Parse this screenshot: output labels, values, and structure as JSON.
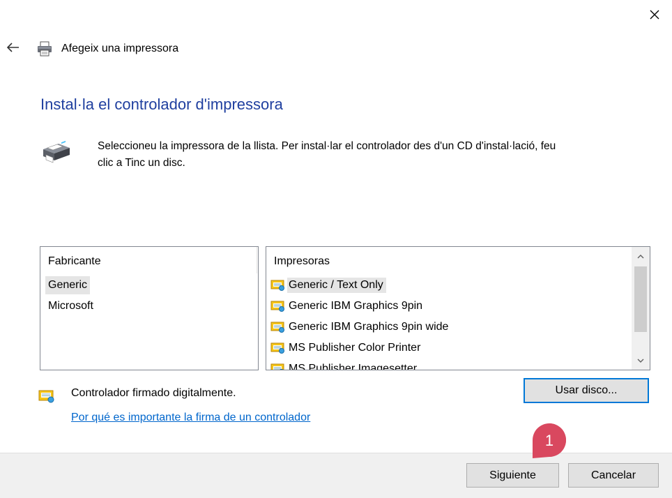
{
  "window": {
    "title": "Afegeix una impressora",
    "close_glyph": "✕",
    "back_glyph": "←"
  },
  "page": {
    "heading": "Instal·la el controlador d'impressora",
    "intro_line1": "Seleccioneu la impressora de la llista. Per instal·lar el controlador des d'un CD d'instal·lació, feu",
    "intro_line2": "clic a Tinc un disc."
  },
  "manufacturers": {
    "header": "Fabricante",
    "items": [
      {
        "label": "Generic",
        "selected": true
      },
      {
        "label": "Microsoft",
        "selected": false
      }
    ]
  },
  "printers": {
    "header": "Impresoras",
    "items": [
      {
        "label": "Generic / Text Only",
        "selected": true
      },
      {
        "label": "Generic IBM Graphics 9pin",
        "selected": false
      },
      {
        "label": "Generic IBM Graphics 9pin wide",
        "selected": false
      },
      {
        "label": "MS Publisher Color Printer",
        "selected": false
      },
      {
        "label": "MS Publisher Imagesetter",
        "selected": false
      }
    ],
    "scroll_up_glyph": "^",
    "scroll_down_glyph": "v"
  },
  "driver": {
    "signed_text": "Controlador firmado digitalmente.",
    "link_text": "Por qué es importante la firma de un controlador",
    "have_disk_label": "Usar disco..."
  },
  "footer": {
    "next_label": "Siguiente",
    "cancel_label": "Cancelar"
  },
  "annotation": {
    "badge_number": "1",
    "badge_color": "#d9485f"
  },
  "colors": {
    "heading": "#1f3f9f",
    "link": "#0066cc",
    "focus_border": "#0078d7",
    "footer_bg": "#f0f0f0"
  }
}
